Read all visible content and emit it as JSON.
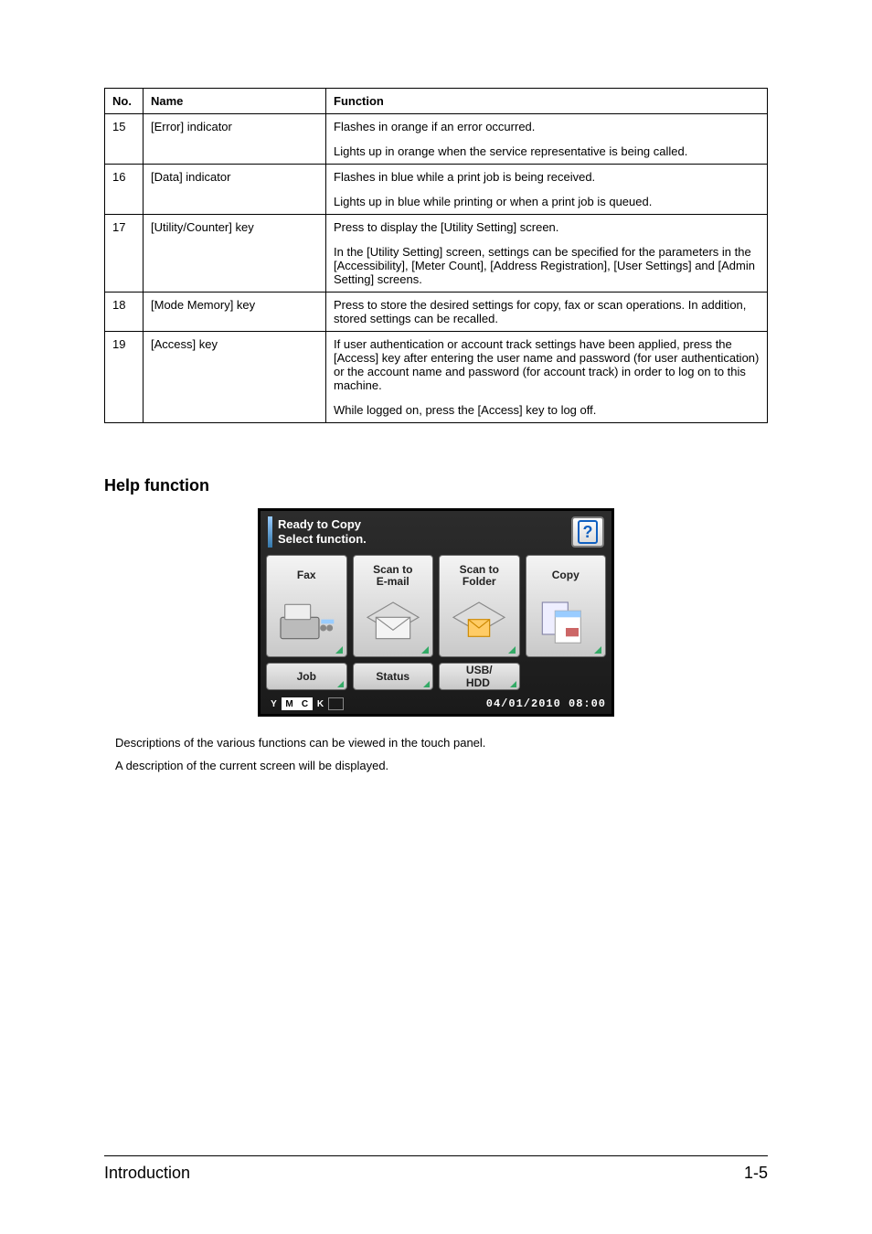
{
  "table": {
    "headers": {
      "no": "No.",
      "name": "Name",
      "function": "Function"
    },
    "rows": [
      {
        "no": "15",
        "name": "[Error] indicator",
        "function": [
          "Flashes in orange if an error occurred.",
          "Lights up in orange when the service representative is being called."
        ]
      },
      {
        "no": "16",
        "name": "[Data] indicator",
        "function": [
          "Flashes in blue while a print job is being received.",
          "Lights up in blue while printing or when a print job is queued."
        ]
      },
      {
        "no": "17",
        "name": "[Utility/Counter] key",
        "function": [
          "Press to display the [Utility Setting] screen.",
          "In the [Utility Setting] screen, settings can be specified for the parameters in the [Accessibility], [Meter Count], [Address Registration], [User Settings] and [Admin Setting] screens."
        ]
      },
      {
        "no": "18",
        "name": "[Mode Memory] key",
        "function": [
          "Press to store the desired settings for copy, fax or scan operations. In addition, stored settings can be recalled."
        ]
      },
      {
        "no": "19",
        "name": "[Access] key",
        "function": [
          "If user authentication or account track settings have been applied, press the [Access] key after entering the user name and password (for user authentication) or the account name and password (for account track) in order to log on to this machine.",
          "While logged on, press the [Access] key to log off."
        ]
      }
    ]
  },
  "help_section": {
    "heading": "Help function",
    "panel": {
      "title_line1": "Ready to Copy",
      "title_line2": "Select function.",
      "help_symbol": "?",
      "tiles": [
        {
          "label": "Fax"
        },
        {
          "label": "Scan to\nE-mail"
        },
        {
          "label": "Scan to\nFolder"
        },
        {
          "label": "Copy"
        }
      ],
      "small_tiles": [
        {
          "label": "Job"
        },
        {
          "label": "Status"
        },
        {
          "label": "USB/\nHDD"
        }
      ],
      "toner_letters": [
        "Y",
        "M",
        "C",
        "K"
      ],
      "datetime": "04/01/2010 08:00"
    },
    "descriptions": [
      "Descriptions of the various functions can be viewed in the touch panel.",
      "A description of the current screen will be displayed."
    ]
  },
  "footer": {
    "left": "Introduction",
    "right": "1-5"
  }
}
